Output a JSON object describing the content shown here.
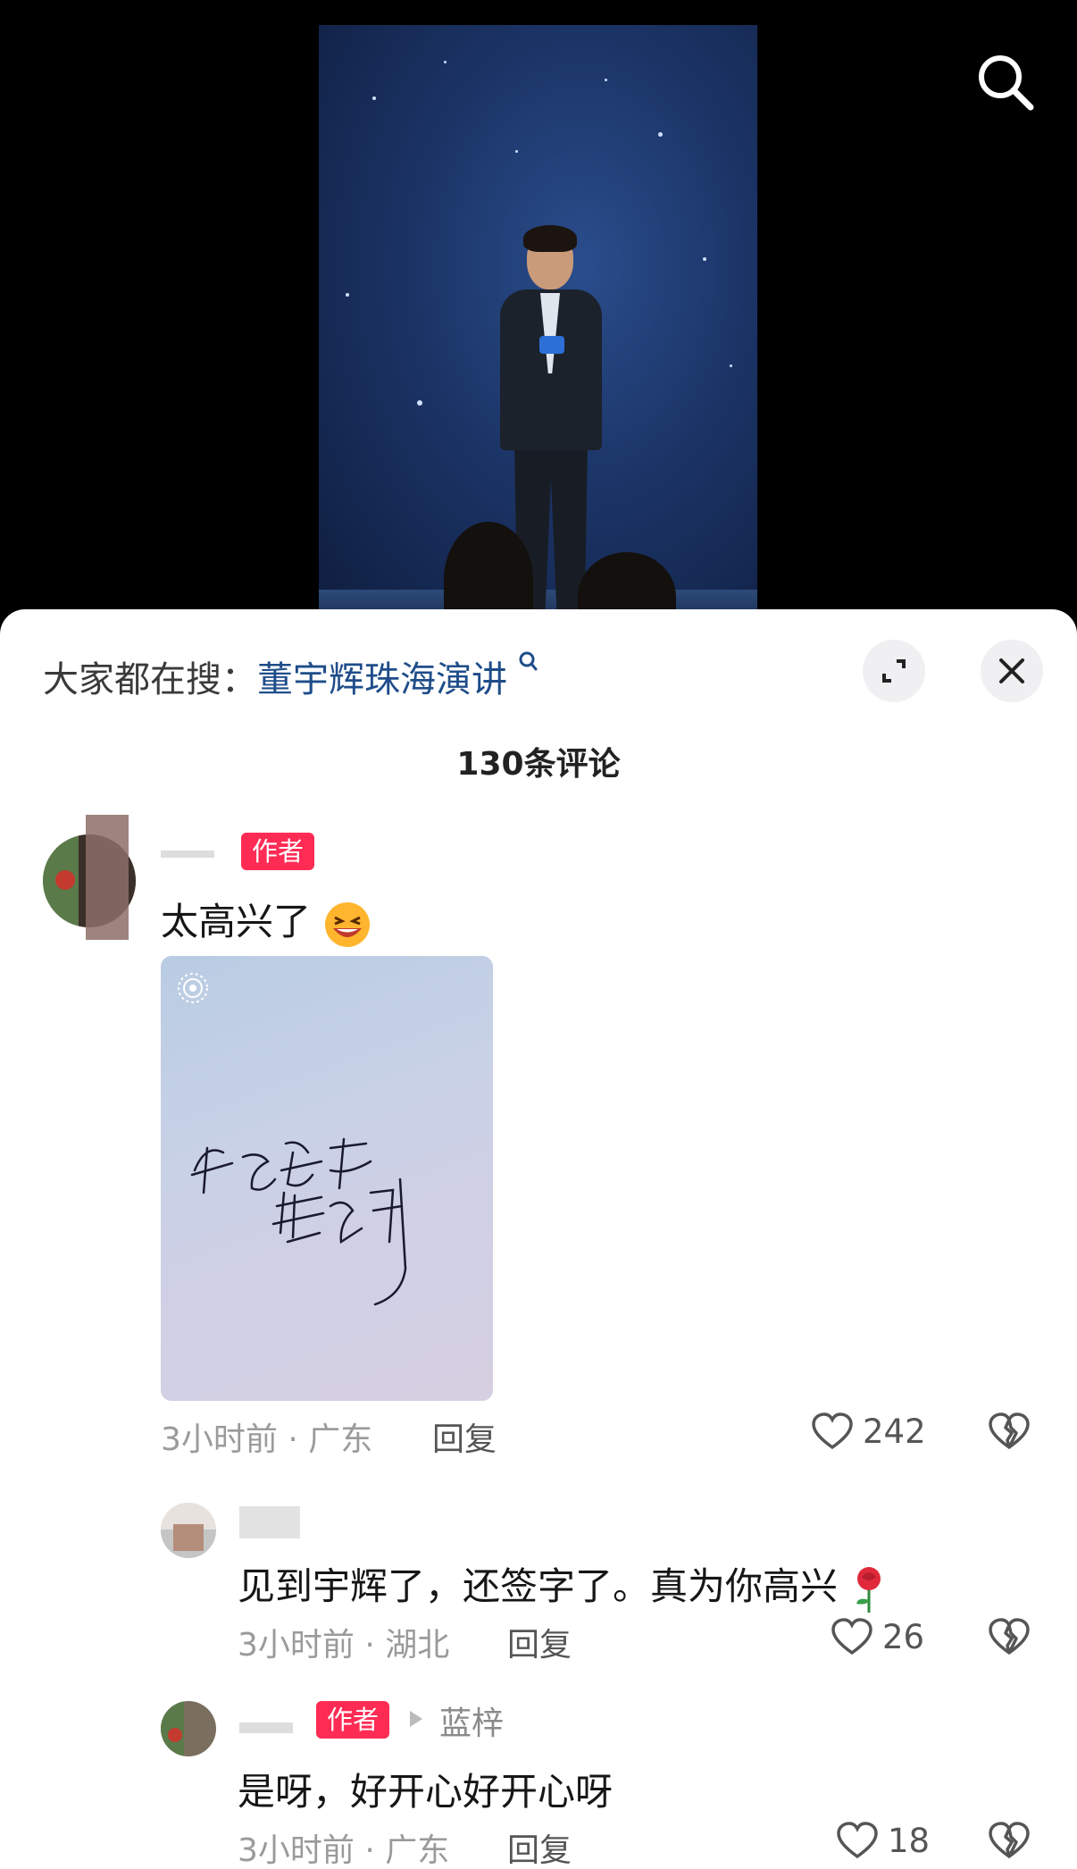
{
  "video": {
    "search_icon": "search-icon"
  },
  "sheet": {
    "trending_prefix": "大家都在搜：",
    "trending_keyword": "董宇辉珠海演讲",
    "comment_count_title": "130条评论",
    "expand_icon": "expand-icon",
    "close_icon": "close-icon"
  },
  "comments": [
    {
      "badge": "作者",
      "text": "太高兴了",
      "emoji": "laughing-emoji",
      "time_location": "3小时前 · 广东",
      "reply_label": "回复",
      "likes": "242",
      "image": {
        "signature_description_icon": "handwritten-signature"
      }
    },
    {
      "text": "见到宇辉了，还签字了。真为你高兴",
      "emoji": "rose-emoji",
      "time_location": "3小时前 · 湖北",
      "reply_label": "回复",
      "likes": "26"
    },
    {
      "badge": "作者",
      "reply_to": "蓝梓",
      "text": "是呀，好开心好开心呀",
      "time_location": "3小时前 · 广东",
      "reply_label": "回复",
      "likes": "18"
    }
  ],
  "colors": {
    "accent_red": "#fe2c55",
    "keyword_blue": "#1f4d8a"
  }
}
